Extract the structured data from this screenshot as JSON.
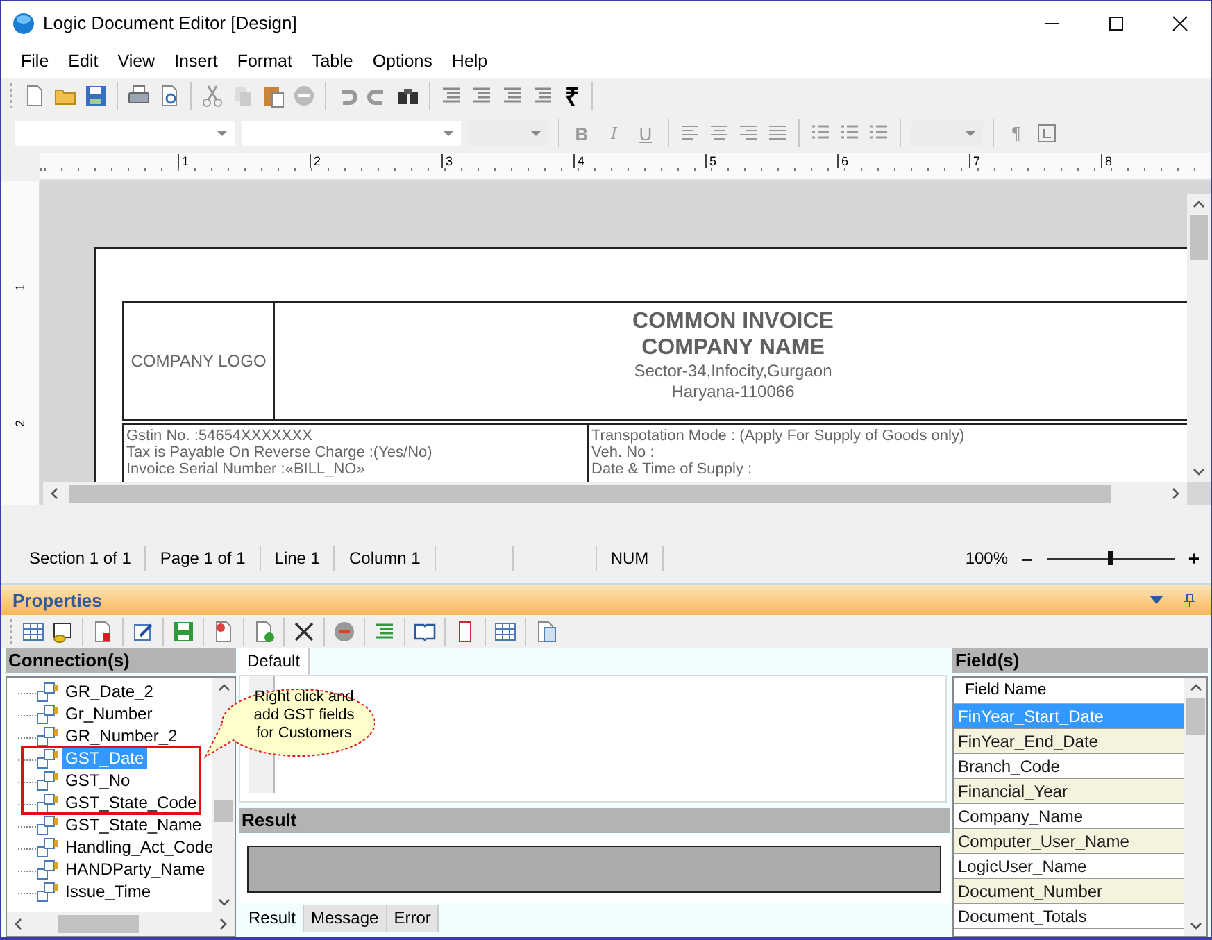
{
  "window": {
    "title": "Logic Document Editor [Design]"
  },
  "menu": [
    "File",
    "Edit",
    "View",
    "Insert",
    "Format",
    "Table",
    "Options",
    "Help"
  ],
  "toolbar": {
    "currency_symbol": "₹"
  },
  "format_toolbar": {
    "buttons": [
      {
        "label": "B",
        "disabled": true
      },
      {
        "label": "I",
        "disabled": true
      },
      {
        "label": "U",
        "disabled": true
      }
    ],
    "paragraph_mark": "¶"
  },
  "ruler": {
    "marks": [
      "1",
      "2",
      "3",
      "4",
      "5",
      "6",
      "7",
      "8"
    ],
    "vertical_marks": [
      "1",
      "2"
    ]
  },
  "document": {
    "logo": "COMPANY LOGO",
    "title": "COMMON INVOICE",
    "company": "COMPANY NAME",
    "address": [
      "Sector-34,Infocity,Gurgaon",
      "Haryana-110066"
    ],
    "left_lines": [
      "Gstin No. :54654XXXXXXX",
      "Tax is Payable On Reverse Charge :(Yes/No)",
      "Invoice Serial Number :«BILL_NO»"
    ],
    "right_lines": [
      "Transpotation Mode : (Apply For Supply of Goods only)",
      "Veh. No :",
      "Date & Time of Supply :"
    ]
  },
  "status_bar": {
    "cells": [
      "Section 1 of 1",
      "Page 1 of 1",
      "Line 1",
      "Column 1"
    ],
    "num": "NUM",
    "zoom": "100%",
    "zoom_out": "–",
    "zoom_in": "+",
    "level": 0.5
  },
  "properties": {
    "title": "Properties"
  },
  "connections": {
    "title": "Connection(s)",
    "items": [
      {
        "label": "GR_Date_2",
        "selected": false,
        "highlighted": false
      },
      {
        "label": "Gr_Number",
        "selected": false,
        "highlighted": false
      },
      {
        "label": "GR_Number_2",
        "selected": false,
        "highlighted": false
      },
      {
        "label": "GST_Date",
        "selected": true,
        "highlighted": true
      },
      {
        "label": "GST_No",
        "selected": false,
        "highlighted": true
      },
      {
        "label": "GST_State_Code",
        "selected": false,
        "highlighted": true
      },
      {
        "label": "GST_State_Name",
        "selected": false,
        "highlighted": false
      },
      {
        "label": "Handling_Act_Code",
        "selected": false,
        "highlighted": false
      },
      {
        "label": "HANDParty_Name",
        "selected": false,
        "highlighted": false
      },
      {
        "label": "Issue_Time",
        "selected": false,
        "highlighted": false
      }
    ]
  },
  "callout": "Right click and add GST fields for Customers",
  "editor_tabs": [
    {
      "label": "Default",
      "selected": true
    }
  ],
  "result": {
    "title": "Result",
    "tabs": [
      {
        "label": "Result",
        "selected": true
      },
      {
        "label": "Message",
        "selected": false
      },
      {
        "label": "Error",
        "selected": false
      }
    ]
  },
  "fields": {
    "title": "Field(s)",
    "column": "Field Name",
    "items": [
      {
        "label": "FinYear_Start_Date",
        "selected": true
      },
      {
        "label": "FinYear_End_Date",
        "selected": false
      },
      {
        "label": "Branch_Code",
        "selected": false
      },
      {
        "label": "Financial_Year",
        "selected": false
      },
      {
        "label": "Company_Name",
        "selected": false
      },
      {
        "label": "Computer_User_Name",
        "selected": false
      },
      {
        "label": "LogicUser_Name",
        "selected": false
      },
      {
        "label": "Document_Number",
        "selected": false
      },
      {
        "label": "Document_Totals",
        "selected": false
      }
    ]
  }
}
